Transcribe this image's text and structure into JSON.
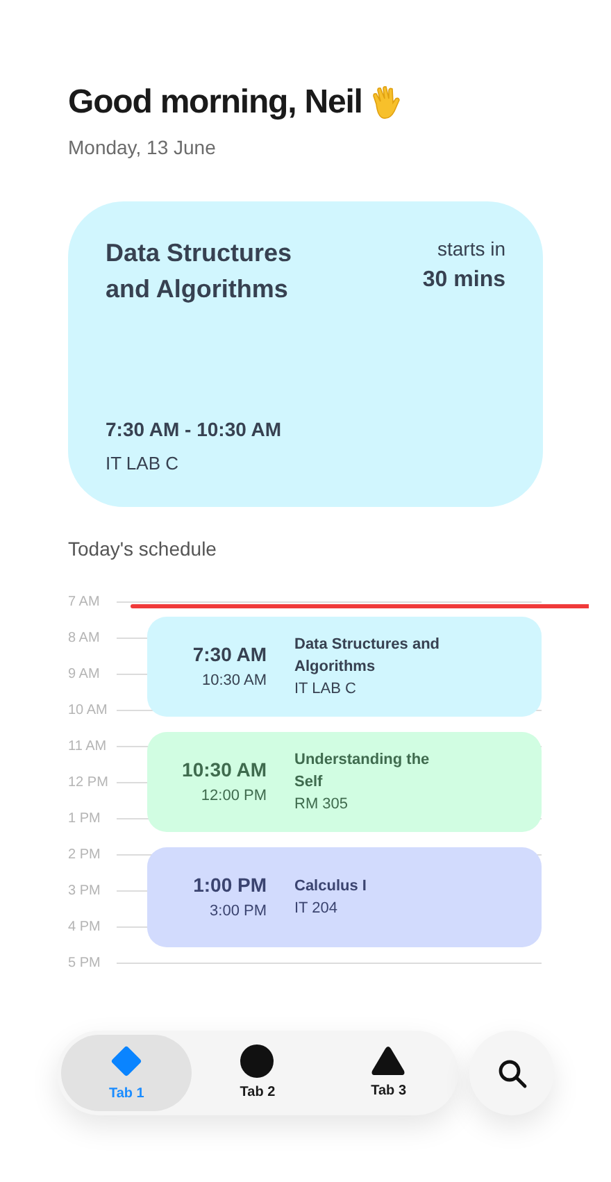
{
  "greeting": "Good morning, Neil",
  "date": "Monday, 13 June",
  "next_class": {
    "title": "Data Structures and Algorithms",
    "starts_label": "starts in",
    "starts_value": "30 mins",
    "time": "7:30 AM - 10:30 AM",
    "room": "IT LAB C"
  },
  "schedule": {
    "title": "Today's schedule",
    "hours": [
      "7 AM",
      "8 AM",
      "9 AM",
      "10 AM",
      "11 AM",
      "12 PM",
      "1 PM",
      "2 PM",
      "3 PM",
      "4 PM",
      "5 PM"
    ],
    "events": [
      {
        "start": "7:30 AM",
        "end": "10:30 AM",
        "title": "Data Structures and Algorithms",
        "room": "IT LAB C",
        "color": "#d1f6fe"
      },
      {
        "start": "10:30 AM",
        "end": "12:00 PM",
        "title": "Understanding the Self",
        "room": "RM 305",
        "color": "#d1fde2"
      },
      {
        "start": "1:00 PM",
        "end": "3:00 PM",
        "title": "Calculus I",
        "room": "IT 204",
        "color": "#d2dbfd"
      }
    ]
  },
  "tabs": [
    {
      "label": "Tab 1",
      "kind": "diamond",
      "selected": true
    },
    {
      "label": "Tab 2",
      "kind": "circle",
      "selected": false
    },
    {
      "label": "Tab 3",
      "kind": "triangle",
      "selected": false
    }
  ]
}
